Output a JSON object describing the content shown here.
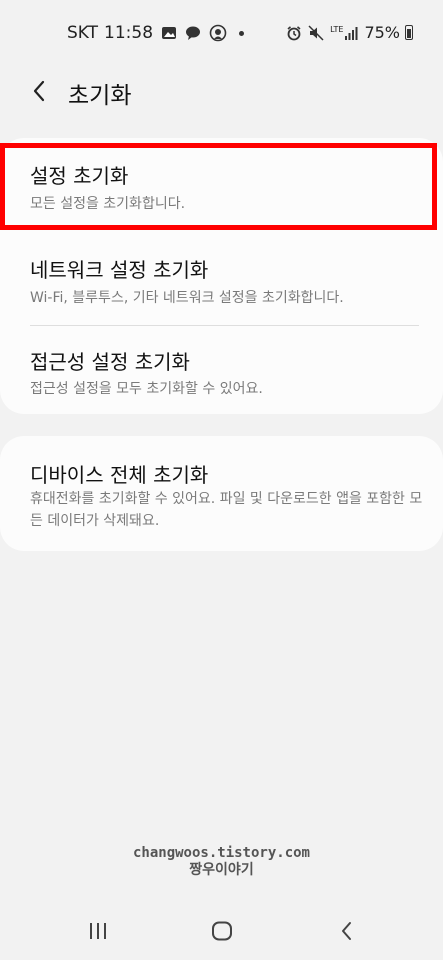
{
  "status_bar": {
    "carrier": "SKT",
    "time": "11:58",
    "network": "LTE",
    "battery": "75%"
  },
  "header": {
    "title": "초기화"
  },
  "reset_options": [
    {
      "title": "설정 초기화",
      "description": "모든 설정을 초기화합니다.",
      "highlighted": true
    },
    {
      "title": "네트워크 설정 초기화",
      "description": "Wi-Fi, 블루투스, 기타 네트워크 설정을 초기화합니다."
    },
    {
      "title": "접근성 설정 초기화",
      "description": "접근성 설정을 모두 초기화할 수 있어요."
    }
  ],
  "factory_reset": {
    "title": "디바이스 전체 초기화",
    "description": "휴대전화를 초기화할 수 있어요. 파일 및 다운로드한 앱을 포함한 모든 데이터가 삭제돼요."
  },
  "watermark": {
    "line1": "changwoos.tistory.com",
    "line2": "짱우이야기"
  },
  "colors": {
    "background": "#f2f2f2",
    "card": "#fcfcfc",
    "highlight": "#ff0000",
    "secondary_text": "#7a7a7a"
  },
  "icons": {
    "status": [
      "gallery-icon",
      "talk-icon",
      "location-icon",
      "alarm-icon",
      "mute-icon",
      "signal-icon",
      "battery-icon"
    ],
    "nav": [
      "recent-apps-icon",
      "home-icon",
      "back-icon"
    ]
  }
}
